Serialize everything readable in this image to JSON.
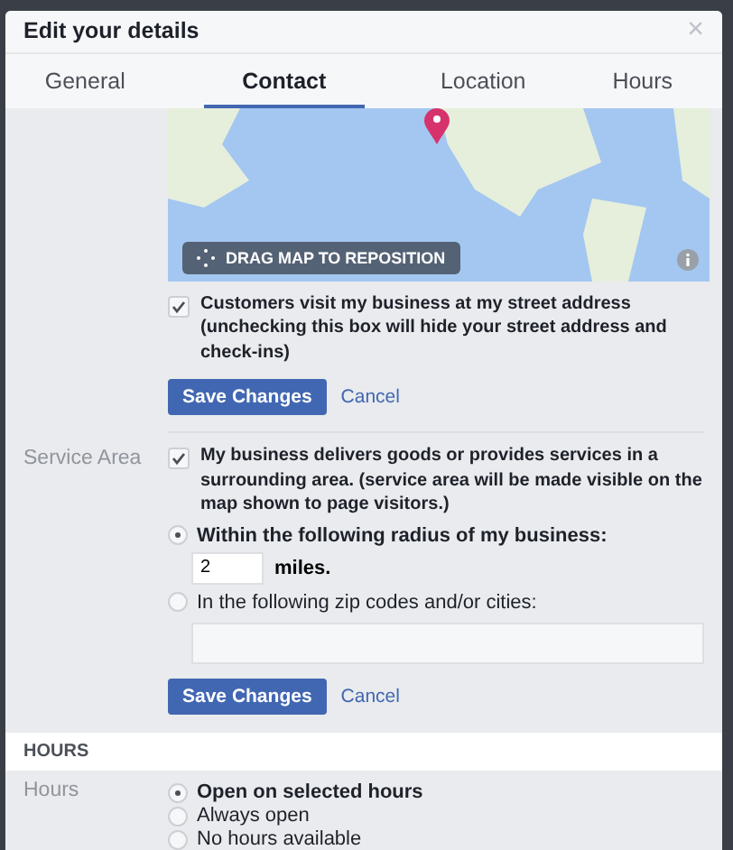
{
  "dialog": {
    "title": "Edit your details",
    "close": "×"
  },
  "tabs": [
    {
      "label": "General",
      "selected": false
    },
    {
      "label": "Contact",
      "selected": true
    },
    {
      "label": "Location",
      "selected": false
    },
    {
      "label": "Hours",
      "selected": false
    }
  ],
  "map": {
    "drag_label": "DRAG MAP TO REPOSITION"
  },
  "address_section": {
    "checkbox": {
      "label": "Customers visit my business at my street address (unchecking this box will hide your street address and check-ins)",
      "checked": true
    },
    "save": "Save Changes",
    "cancel": "Cancel"
  },
  "service_area": {
    "label": "Service Area",
    "checkbox": {
      "label": "My business delivers goods or provides services in a surrounding area. (service area will be made visible on the map shown to page visitors.)",
      "checked": true
    },
    "options": [
      {
        "kind": "radius",
        "label": "Within the following radius of my business:",
        "selected": true,
        "value": "2",
        "unit": "miles."
      },
      {
        "kind": "cities",
        "label": "In the following zip codes and/or cities:",
        "selected": false
      }
    ],
    "save": "Save Changes",
    "cancel": "Cancel"
  },
  "hours_section": {
    "heading": "HOURS",
    "label": "Hours",
    "options": [
      {
        "label": "Open on selected hours",
        "selected": true
      },
      {
        "label": "Always open",
        "selected": false
      },
      {
        "label": "No hours available",
        "selected": false
      }
    ]
  }
}
